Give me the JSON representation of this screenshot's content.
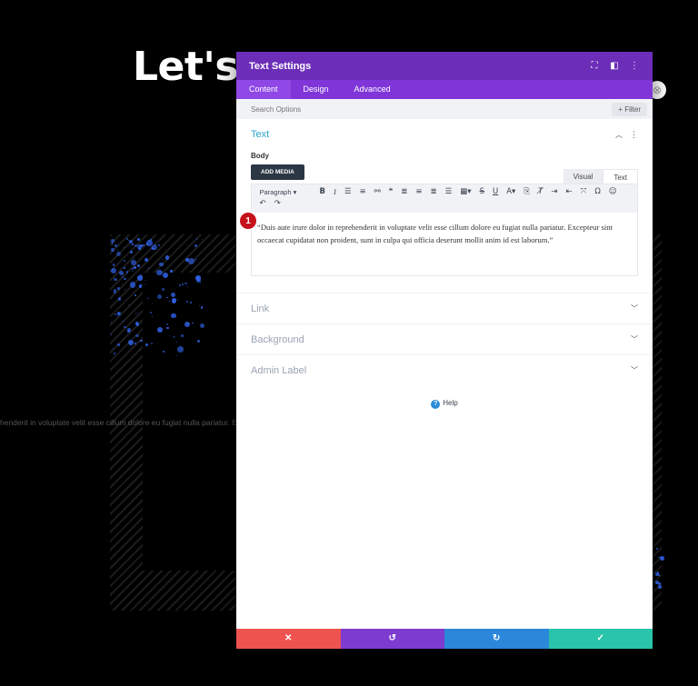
{
  "background": {
    "heading": "Let's",
    "body_snippet": "henderit in voluptate velit esse cillum dolore eu fugiat nulla pariatur. Ex"
  },
  "modal": {
    "title": "Text Settings",
    "tabs": [
      {
        "label": "Content",
        "active": true
      },
      {
        "label": "Design",
        "active": false
      },
      {
        "label": "Advanced",
        "active": false
      }
    ],
    "search_placeholder": "Search Options",
    "filter_label": "+ Filter",
    "text_section": {
      "title": "Text",
      "body_label": "Body",
      "add_media_label": "ADD MEDIA",
      "editor_tabs": [
        "Visual",
        "Text"
      ],
      "active_editor_tab": "Text",
      "paragraph_select": "Paragraph",
      "content": "“Duis aute irure dolor in reprehenderit in voluptate velit esse cillum dolore eu fugiat nulla pariatur. Excepteur sint occaecat cupidatat non proident, sunt in culpa qui officia deserunt mollit anim id est laborum.”",
      "step_badge": "1"
    },
    "collapsed_sections": [
      "Link",
      "Background",
      "Admin Label"
    ],
    "help_label": "Help",
    "footer_colors": {
      "discard": "#ef5350",
      "undo": "#7e3bd0",
      "redo": "#2b87da",
      "save": "#29c4a9"
    }
  },
  "colors": {
    "header": "#6c2eb9",
    "tabs": "#8035d8",
    "accent_title": "#2aa5c9"
  }
}
